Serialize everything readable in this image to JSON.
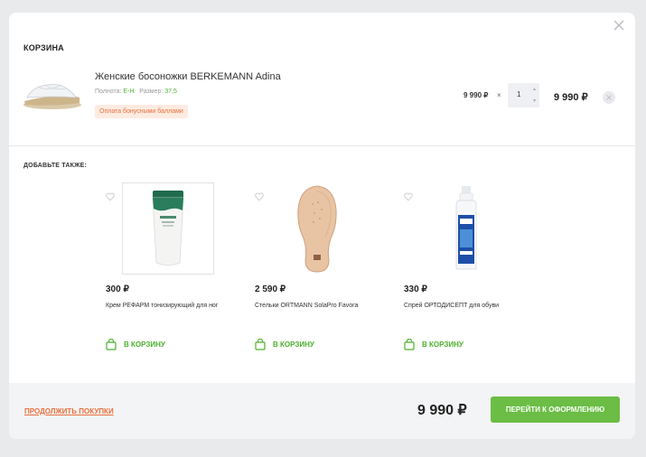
{
  "cart": {
    "title": "КОРЗИНА",
    "item": {
      "name": "Женские босоножки BERKEMANN Adina",
      "fullness_label": "Полнота:",
      "fullness_value": "E-H",
      "size_label": "Размер:",
      "size_value": "37,5",
      "bonus_badge": "Оплата бонусными баллами",
      "unit_price": "9 990 ₽",
      "times": "×",
      "quantity": "1",
      "total_price": "9 990 ₽"
    }
  },
  "also": {
    "title": "ДОБАВЬТЕ ТАКЖЕ:",
    "products": [
      {
        "price": "300 ₽",
        "name": "Крем РЕФАРМ тонизирующий для ног",
        "button": "В КОРЗИНУ"
      },
      {
        "price": "2 590 ₽",
        "name": "Стельки ORTMANN SolaPro Favora",
        "button": "В КОРЗИНУ"
      },
      {
        "price": "330 ₽",
        "name": "Спрей ОРТОДИСЕПТ для обуви",
        "button": "В КОРЗИНУ"
      }
    ]
  },
  "footer": {
    "continue_label": "ПРОДОЛЖИТЬ ПОКУПКИ",
    "total": "9 990 ₽",
    "checkout_label": "ПЕРЕЙТИ К ОФОРМЛЕНИЮ"
  },
  "colors": {
    "accent_green": "#6bbd45",
    "accent_orange": "#e8713c"
  },
  "icons": [
    "close-icon",
    "heart-icon",
    "cart-bag-icon",
    "remove-icon"
  ]
}
